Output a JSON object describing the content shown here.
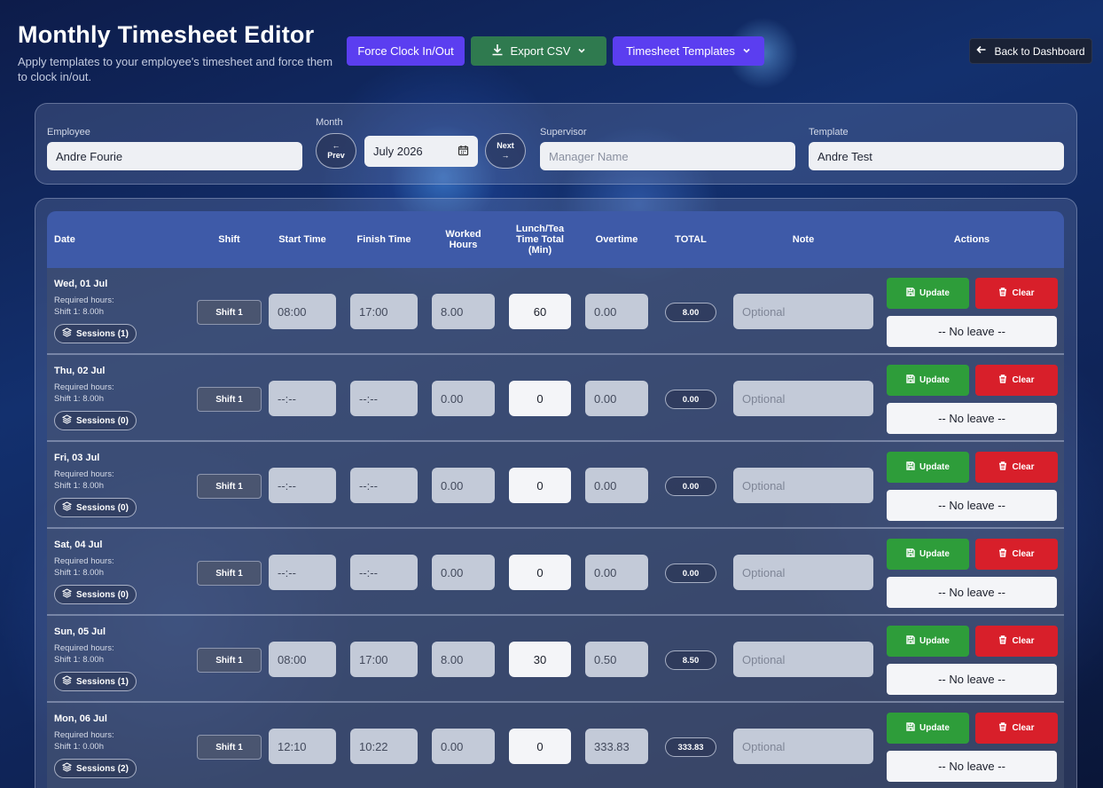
{
  "header": {
    "title": "Monthly Timesheet Editor",
    "subtitle": "Apply templates to your employee's timesheet and force them to clock in/out."
  },
  "toolbar": {
    "force_label": "Force Clock In/Out",
    "export_label": "Export CSV",
    "templates_label": "Timesheet Templates",
    "back_label": "Back to Dashboard"
  },
  "filters": {
    "employee_label": "Employee",
    "employee_value": "Andre Fourie",
    "month_label": "Month",
    "prev_arrow": "←",
    "prev_label": "Prev",
    "month_value": "July 2026",
    "next_label": "Next",
    "next_arrow": "→",
    "supervisor_label": "Supervisor",
    "supervisor_placeholder": "Manager Name",
    "template_label": "Template",
    "template_value": "Andre Test"
  },
  "columns": {
    "date": "Date",
    "shift": "Shift",
    "start": "Start Time",
    "finish": "Finish Time",
    "worked_1": "Worked",
    "worked_2": "Hours",
    "lunch_1": "Lunch/Tea",
    "lunch_2": "Time Total",
    "lunch_3": "(Min)",
    "overtime": "Overtime",
    "total": "TOTAL",
    "note": "Note",
    "actions": "Actions"
  },
  "labels": {
    "required": "Required hours:",
    "update": "Update",
    "clear": "Clear",
    "no_leave": "-- No leave --",
    "note_placeholder": "Optional"
  },
  "rows": [
    {
      "date": "Wed, 01 Jul",
      "req": "Shift 1: 8.00h",
      "sessions": "Sessions (1)",
      "shift": "Shift 1",
      "start": "08:00",
      "finish": "17:00",
      "worked": "8.00",
      "lunch": "60",
      "overtime": "0.00",
      "total": "8.00"
    },
    {
      "date": "Thu, 02 Jul",
      "req": "Shift 1: 8.00h",
      "sessions": "Sessions (0)",
      "shift": "Shift 1",
      "start": "--:--",
      "finish": "--:--",
      "worked": "0.00",
      "lunch": "0",
      "overtime": "0.00",
      "total": "0.00"
    },
    {
      "date": "Fri, 03 Jul",
      "req": "Shift 1: 8.00h",
      "sessions": "Sessions (0)",
      "shift": "Shift 1",
      "start": "--:--",
      "finish": "--:--",
      "worked": "0.00",
      "lunch": "0",
      "overtime": "0.00",
      "total": "0.00"
    },
    {
      "date": "Sat, 04 Jul",
      "req": "Shift 1: 8.00h",
      "sessions": "Sessions (0)",
      "shift": "Shift 1",
      "start": "--:--",
      "finish": "--:--",
      "worked": "0.00",
      "lunch": "0",
      "overtime": "0.00",
      "total": "0.00"
    },
    {
      "date": "Sun, 05 Jul",
      "req": "Shift 1: 8.00h",
      "sessions": "Sessions (1)",
      "shift": "Shift 1",
      "start": "08:00",
      "finish": "17:00",
      "worked": "8.00",
      "lunch": "30",
      "overtime": "0.50",
      "total": "8.50"
    },
    {
      "date": "Mon, 06 Jul",
      "req": "Shift 1: 0.00h",
      "sessions": "Sessions (2)",
      "shift": "Shift 1",
      "start": "12:10",
      "finish": "10:22",
      "worked": "0.00",
      "lunch": "0",
      "overtime": "333.83",
      "total": "333.83"
    }
  ],
  "icons": {
    "download": "download-icon",
    "chevron": "chevron-down-icon",
    "back": "arrow-left-icon",
    "calendar": "calendar-icon",
    "layers": "layers-icon",
    "save": "save-icon",
    "trash": "trash-icon"
  },
  "colors": {
    "primary": "#5b3ef0",
    "export": "#2f7a4f",
    "update": "#2e9d3a",
    "clear": "#d81f2a",
    "table_header": "#3e5aa8"
  }
}
